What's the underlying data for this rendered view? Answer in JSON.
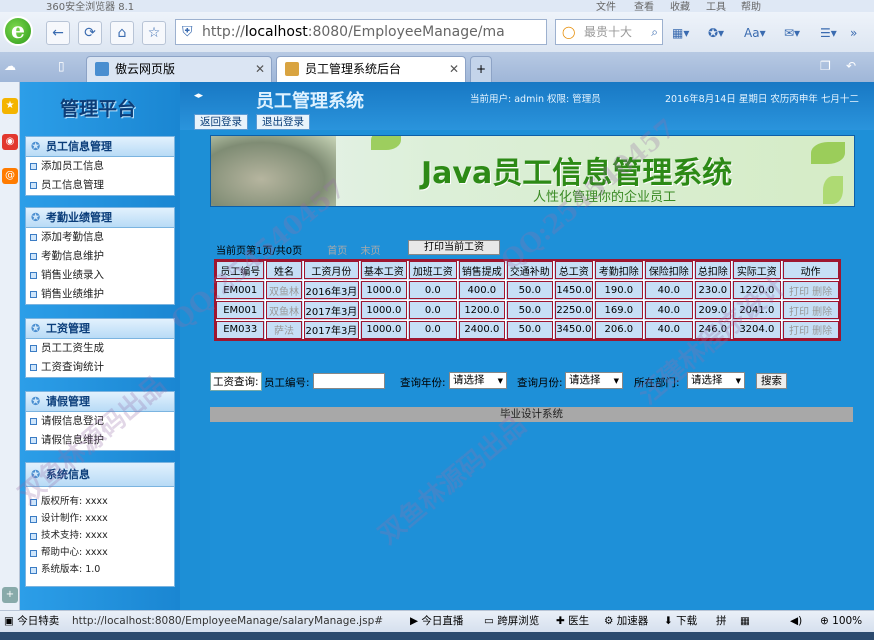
{
  "browser": {
    "app_title": "360安全浏览器 8.1",
    "menus": [
      "文件",
      "查看",
      "收藏",
      "工具",
      "帮助"
    ],
    "url_host": "localhost",
    "url_rest": ":8080/EmployeeManage/ma",
    "url_prefix": "http://",
    "search_placeholder": "最贵十大",
    "tabs": [
      {
        "label": "傲云网页版"
      },
      {
        "label": "员工管理系统后台"
      }
    ],
    "status_url": "http://localhost:8080/EmployeeManage/salaryManage.jsp#",
    "status_left": "今日特卖",
    "status_items": [
      "今日直播",
      "跨屏浏览",
      "医生",
      "加速器",
      "下载"
    ],
    "zoom": "100%"
  },
  "sidebar": {
    "brand": "管理平台",
    "panels": [
      {
        "title": "员工信息管理",
        "items": [
          "添加员工信息",
          "员工信息管理"
        ]
      },
      {
        "title": "考勤业绩管理",
        "items": [
          "添加考勤信息",
          "考勤信息维护",
          "销售业绩录入",
          "销售业绩维护"
        ]
      },
      {
        "title": "工资管理",
        "items": [
          "员工工资生成",
          "工资查询统计"
        ]
      },
      {
        "title": "请假管理",
        "items": [
          "请假信息登记",
          "请假信息维护"
        ]
      },
      {
        "title": "系统信息",
        "items": [
          "版权所有: xxxx",
          "设计制作: xxxx",
          "技术支持: xxxx",
          "帮助中心: xxxx",
          "系统版本: 1.0"
        ]
      }
    ]
  },
  "header": {
    "title": "员工管理系统",
    "user_info": "当前用户: admin 权限: 管理员",
    "date_info": "2016年8月14日 星期日 农历丙申年 七月十二",
    "back_login": "返回登录",
    "logout": "退出登录"
  },
  "banner": {
    "title": "Java员工信息管理系统",
    "subtitle": "人性化管理你的企业员工"
  },
  "pager": {
    "text": "当前页第1页/共0页",
    "first": "首页",
    "last": "末页",
    "print": "打印当前工资"
  },
  "table": {
    "headers": [
      "员工编号",
      "姓名",
      "工资月份",
      "基本工资",
      "加班工资",
      "销售提成",
      "交通补助",
      "总工资",
      "考勤扣除",
      "保险扣除",
      "总扣除",
      "实际工资",
      "动作"
    ],
    "rows": [
      [
        "EM001",
        "双鱼林",
        "2016年3月",
        "1000.0",
        "0.0",
        "400.0",
        "50.0",
        "1450.0",
        "190.0",
        "40.0",
        "230.0",
        "1220.0"
      ],
      [
        "EM001",
        "双鱼林",
        "2017年3月",
        "1000.0",
        "0.0",
        "1200.0",
        "50.0",
        "2250.0",
        "169.0",
        "40.0",
        "209.0",
        "2041.0"
      ],
      [
        "EM033",
        "萨法",
        "2017年3月",
        "1000.0",
        "0.0",
        "2400.0",
        "50.0",
        "3450.0",
        "206.0",
        "40.0",
        "246.0",
        "3204.0"
      ]
    ],
    "action_print": "打印",
    "action_delete": "删除"
  },
  "query": {
    "tag": "工资查询:",
    "emp_label": "员工编号:",
    "year_label": "查询年份:",
    "year_value": "请选择",
    "month_label": "查询月份:",
    "month_value": "请选择",
    "dept_label": "所在部门:",
    "dept_value": "请选择",
    "search": "搜索"
  },
  "footer": "毕业设计系统",
  "watermarks": [
    "双鱼林源码出品",
    "QQ:254540457",
    "汪建林程序设计"
  ]
}
